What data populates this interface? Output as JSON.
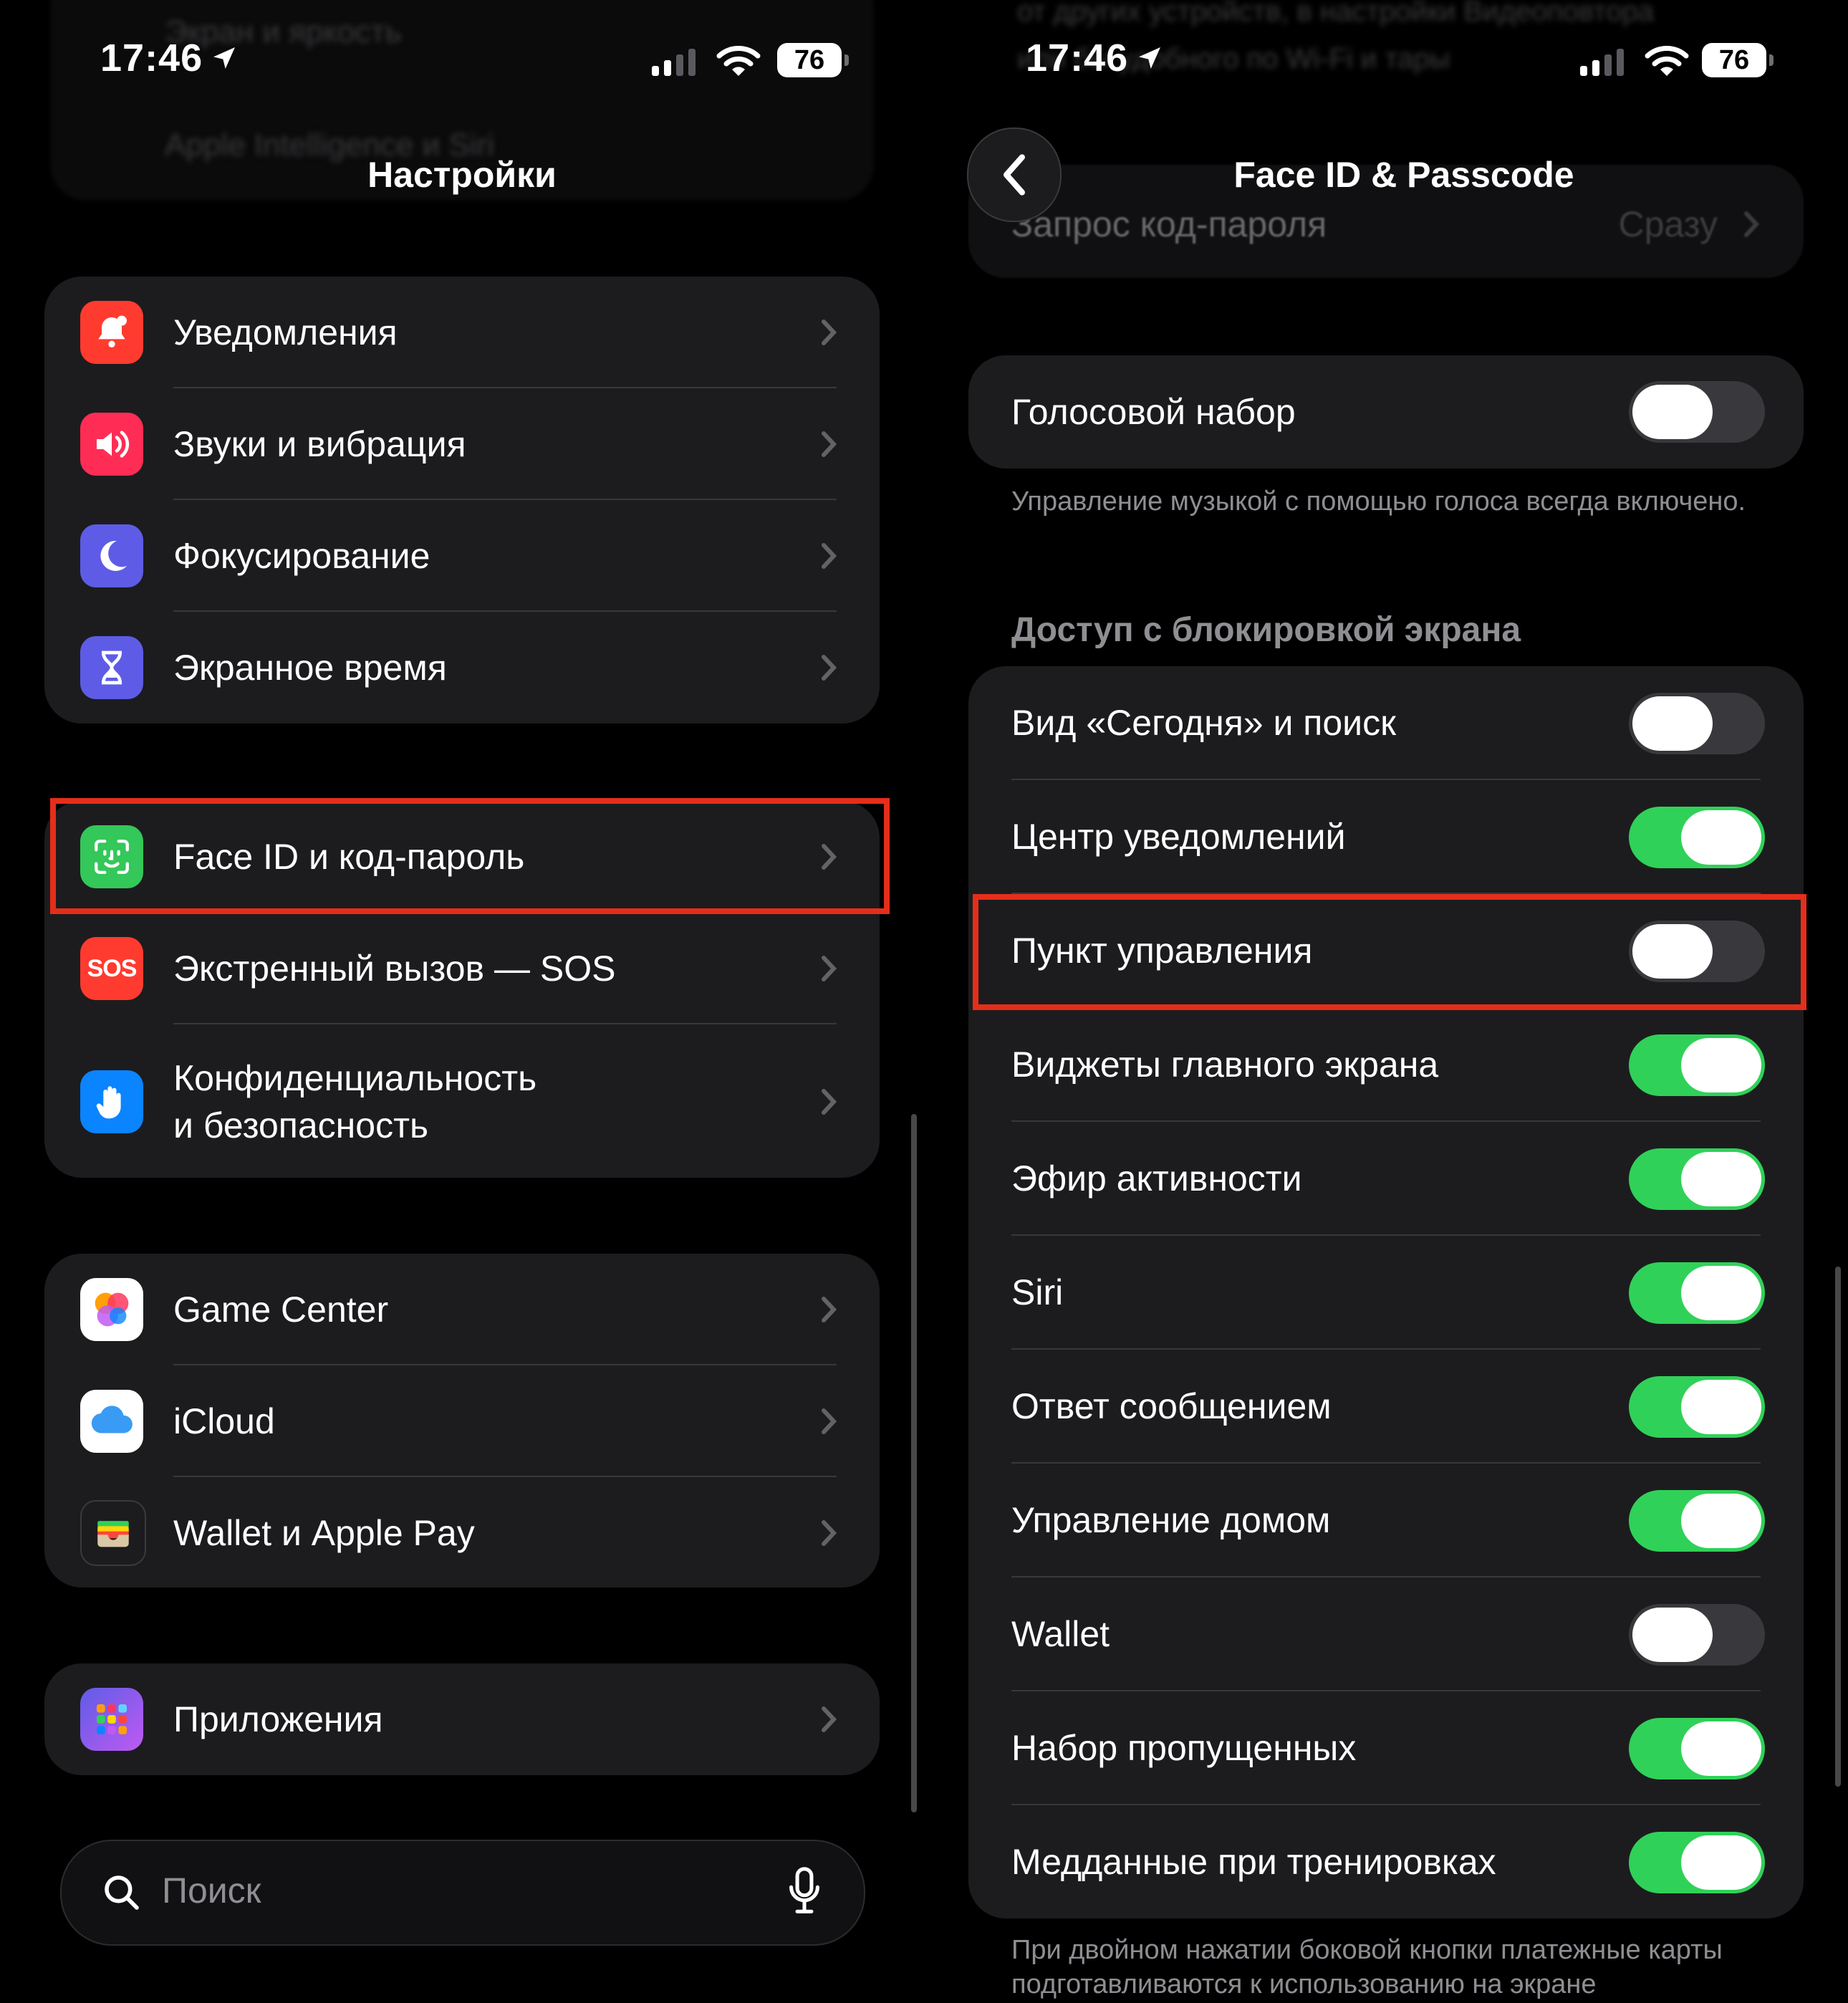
{
  "left": {
    "status": {
      "time": "17:46",
      "battery": "76"
    },
    "ghost_rows": [
      "Экран и яркость",
      "Apple Intelligence и Siri"
    ],
    "title": "Настройки",
    "group1": [
      {
        "label": "Уведомления",
        "icon": "bell-icon",
        "color": "#ff3b30"
      },
      {
        "label": "Звуки и вибрация",
        "icon": "speaker-icon",
        "color": "#ff2d55"
      },
      {
        "label": "Фокусирование",
        "icon": "moon-icon",
        "color": "#5e5ce6"
      },
      {
        "label": "Экранное время",
        "icon": "hourglass-icon",
        "color": "#5e5ce6"
      }
    ],
    "group2": [
      {
        "label": "Face ID и код-пароль",
        "icon": "face-id-icon",
        "color": "#34c759"
      },
      {
        "label": "Экстренный вызов — SOS",
        "icon": "sos-icon",
        "color": "#ff3b30",
        "icon_text": "SOS"
      },
      {
        "label_line1": "Конфиденциальность",
        "label_line2": "и безопасность",
        "icon": "hand-icon",
        "color": "#0a84ff"
      }
    ],
    "group3": [
      {
        "label": "Game Center",
        "icon": "game-center-icon"
      },
      {
        "label": "iCloud",
        "icon": "icloud-icon"
      },
      {
        "label": "Wallet и Apple Pay",
        "icon": "wallet-icon"
      }
    ],
    "group4": [
      {
        "label": "Приложения",
        "icon": "apps-grid-icon",
        "color": "#5e5ce6"
      }
    ],
    "search": {
      "placeholder": "Поиск"
    }
  },
  "right": {
    "status": {
      "time": "17:46",
      "battery": "76"
    },
    "ghost_text": [
      "от других устройств, в настройки Видеоповтора",
      "или бы удобного по Wi-Fi и тары"
    ],
    "title": "Face ID & Passcode",
    "passcode_row": {
      "label": "Запрос код-пароля",
      "value": "Сразу"
    },
    "voice_dial": {
      "label": "Голосовой набор",
      "on": false
    },
    "voice_footer": "Управление музыкой с помощью голоса всегда включено.",
    "lock_header": "Доступ с блокировкой экрана",
    "lock_items": [
      {
        "label": "Вид «Сегодня» и поиск",
        "on": false
      },
      {
        "label": "Центр уведомлений",
        "on": true
      },
      {
        "label": "Пункт управления",
        "on": false
      },
      {
        "label": "Виджеты главного экрана",
        "on": true
      },
      {
        "label": "Эфир активности",
        "on": true
      },
      {
        "label": "Siri",
        "on": true
      },
      {
        "label": "Ответ сообщением",
        "on": true
      },
      {
        "label": "Управление домом",
        "on": true
      },
      {
        "label": "Wallet",
        "on": false
      },
      {
        "label": "Набор пропущенных",
        "on": true
      },
      {
        "label": "Медданные при тренировках",
        "on": true
      }
    ],
    "bottom_footer": "При двойном нажатии боковой кнопки платежные карты подготавливаются к использованию на экране"
  },
  "colors": {
    "toggle_on": "#30d158",
    "toggle_off": "#39393d",
    "highlight": "#e52e1a"
  }
}
